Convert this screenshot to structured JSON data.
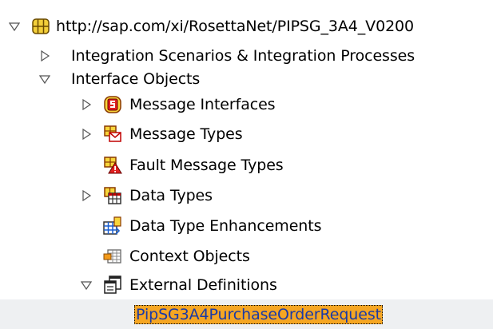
{
  "tree": {
    "root": {
      "label": "http://sap.com/xi/RosettaNet/PIPSG_3A4_V0200"
    },
    "integration_scenarios": {
      "label": "Integration Scenarios & Integration Processes"
    },
    "interface_objects": {
      "label": "Interface Objects",
      "items": {
        "message_interfaces": "Message Interfaces",
        "message_types": "Message Types",
        "fault_message_types": "Fault Message Types",
        "data_types": "Data Types",
        "data_type_enhancements": "Data Type Enhancements",
        "context_objects": "Context Objects",
        "external_definitions": "External Definitions"
      }
    },
    "selected_item": {
      "label": "PipSG3A4PurchaseOrderRequest"
    }
  },
  "colors": {
    "selection": "#f5a623",
    "selected_text": "#1a3aa6",
    "selected_row": "#eef0f2"
  }
}
